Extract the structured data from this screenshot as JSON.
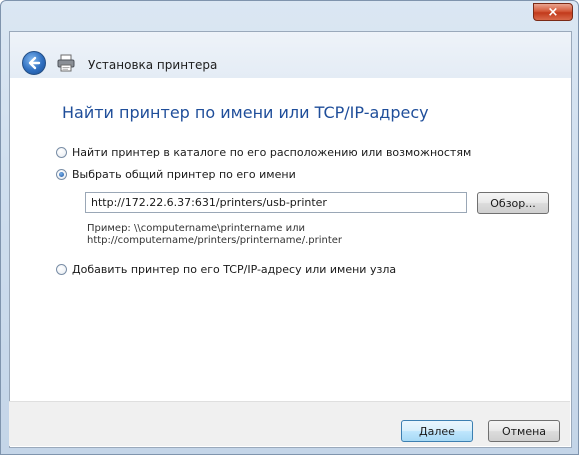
{
  "window": {
    "close_symbol": "×"
  },
  "header": {
    "title": "Установка принтера",
    "back_icon": "back-arrow-icon",
    "printer_icon": "printer-icon"
  },
  "main": {
    "heading": "Найти принтер по имени или  TCP/IP-адресу",
    "options": [
      {
        "label": "Найти принтер в каталоге по его расположению или возможностям",
        "checked": false
      },
      {
        "label": "Выбрать общий принтер по его имени",
        "checked": true
      },
      {
        "label": "Добавить принтер по его TCP/IP-адресу или имени узла",
        "checked": false
      }
    ],
    "shared_printer": {
      "value": "http://172.22.6.37:631/printers/usb-printer",
      "browse_label": "Обзор...",
      "example_line1": "Пример: \\\\computername\\printername или",
      "example_line2": "http://computername/printers/printername/.printer"
    }
  },
  "footer": {
    "next_label": "Далее",
    "cancel_label": "Отмена"
  }
}
